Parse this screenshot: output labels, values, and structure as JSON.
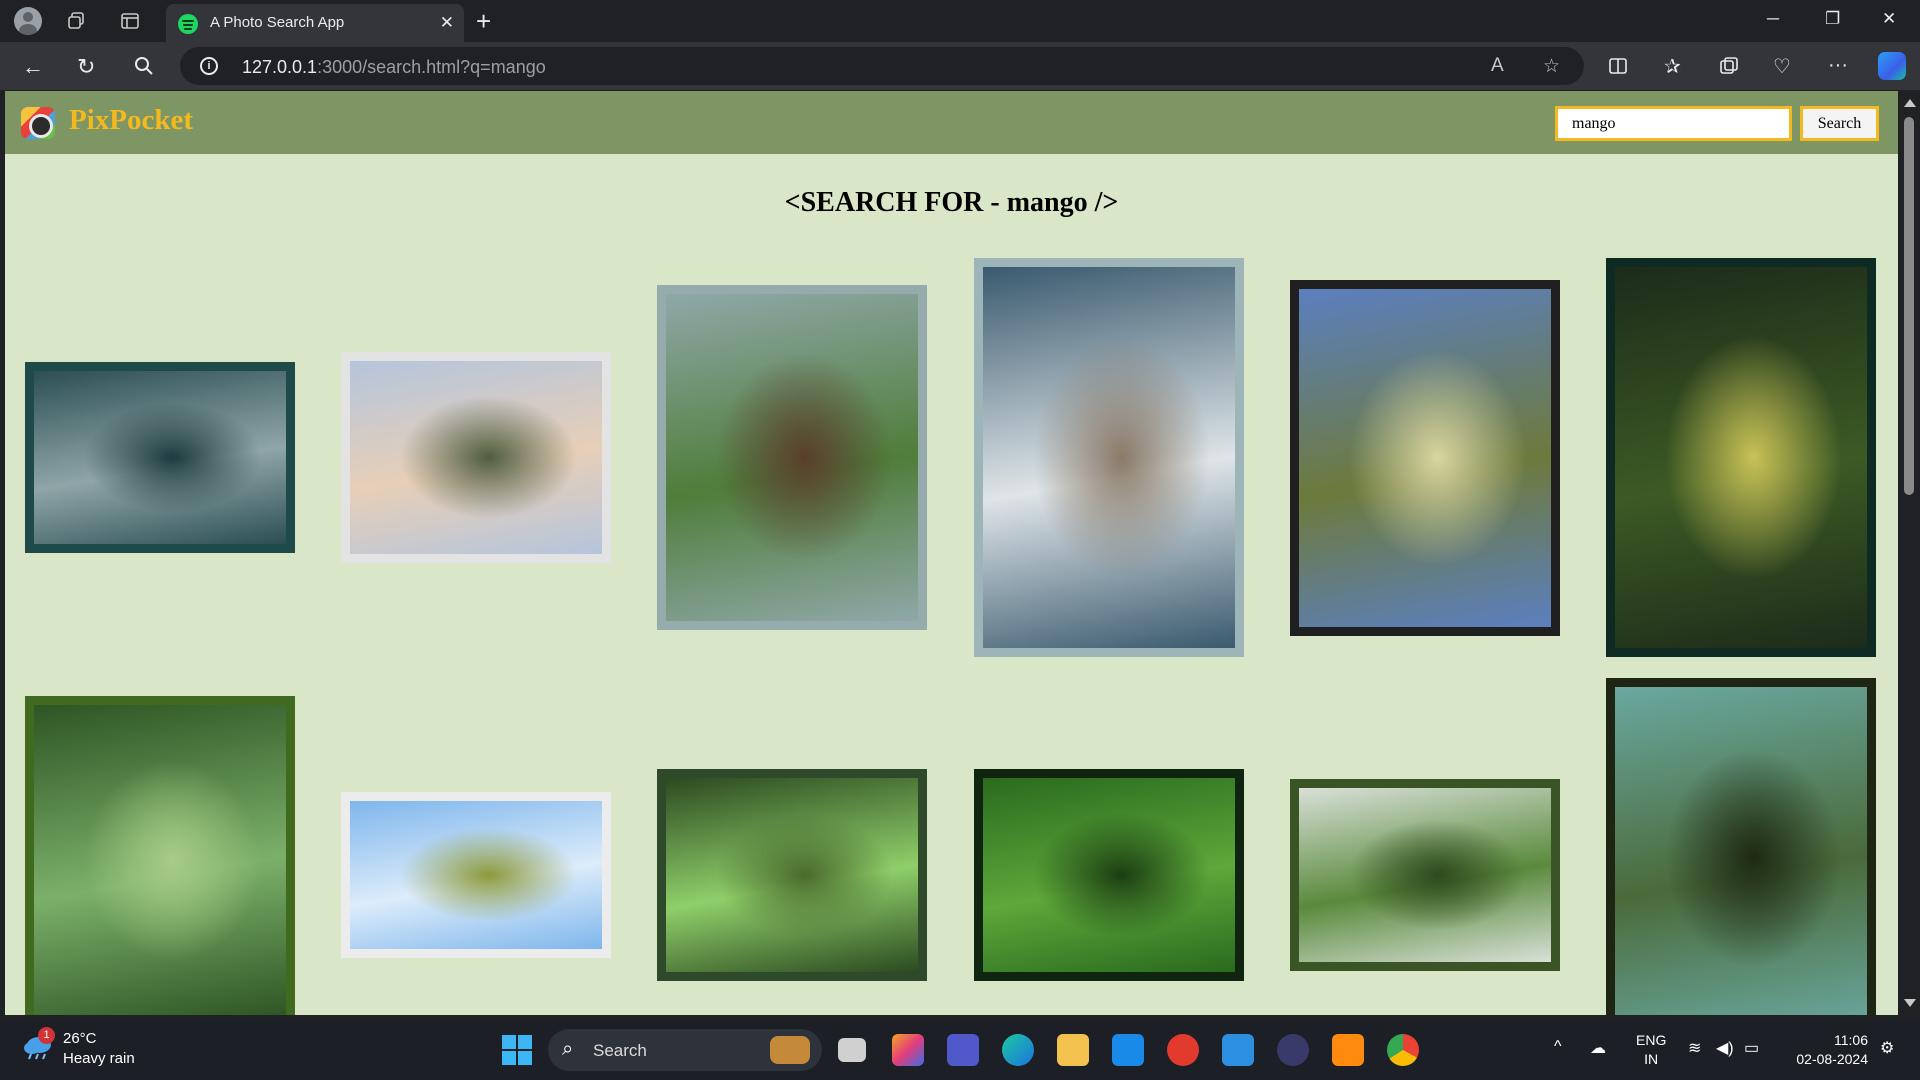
{
  "browser": {
    "tab_title": "A Photo Search App",
    "url_host": "127.0.0.1",
    "url_rest": ":3000/search.html?q=mango"
  },
  "app": {
    "brand": "PixPocket",
    "search_value": "mango",
    "search_button": "Search",
    "heading": "<SEARCH FOR - mango />"
  },
  "photos": [
    {
      "subject": "misty forest road",
      "colors": [
        "#2c4f52",
        "#8fa5a8",
        "#1d3b3e"
      ]
    },
    {
      "subject": "hills at sunset",
      "colors": [
        "#b5c5dc",
        "#e7cfb8",
        "#4f5d3e"
      ]
    },
    {
      "subject": "myna bird on wire",
      "colors": [
        "#8fa8a8",
        "#4f7d3a",
        "#5a3f2c"
      ]
    },
    {
      "subject": "mango seltzer can",
      "colors": [
        "#3a5a6e",
        "#dfe5e8",
        "#8a7a68"
      ]
    },
    {
      "subject": "mango on branch",
      "colors": [
        "#5b7fc0",
        "#6d7a3c",
        "#d8d5a0"
      ]
    },
    {
      "subject": "hanging mango dark",
      "colors": [
        "#1c2c1a",
        "#3d5a24",
        "#c9c256"
      ]
    },
    {
      "subject": "green mango close-up",
      "colors": [
        "#2e5524",
        "#7bb06a",
        "#a7cc86"
      ]
    },
    {
      "subject": "mangoes against sky",
      "colors": [
        "#7fb6ec",
        "#dcecfa",
        "#8d9a3c"
      ]
    },
    {
      "subject": "mango cluster on tree",
      "colors": [
        "#2c4a20",
        "#8fcf6a",
        "#4a6a2c"
      ]
    },
    {
      "subject": "pile of green mangoes",
      "colors": [
        "#2a6a1e",
        "#5da83a",
        "#1b3d12"
      ]
    },
    {
      "subject": "mango tree leaves",
      "colors": [
        "#d8e0d8",
        "#5a8a3c",
        "#2e4a1e"
      ]
    },
    {
      "subject": "blue-green mangoes",
      "colors": [
        "#6aa8a0",
        "#4a6a3a",
        "#1e2a14"
      ]
    }
  ],
  "taskbar": {
    "weather_badge": "1",
    "temperature": "26°C",
    "condition": "Heavy rain",
    "search_label": "Search",
    "lang_top": "ENG",
    "lang_bottom": "IN",
    "time": "11:06",
    "date": "02-08-2024"
  }
}
